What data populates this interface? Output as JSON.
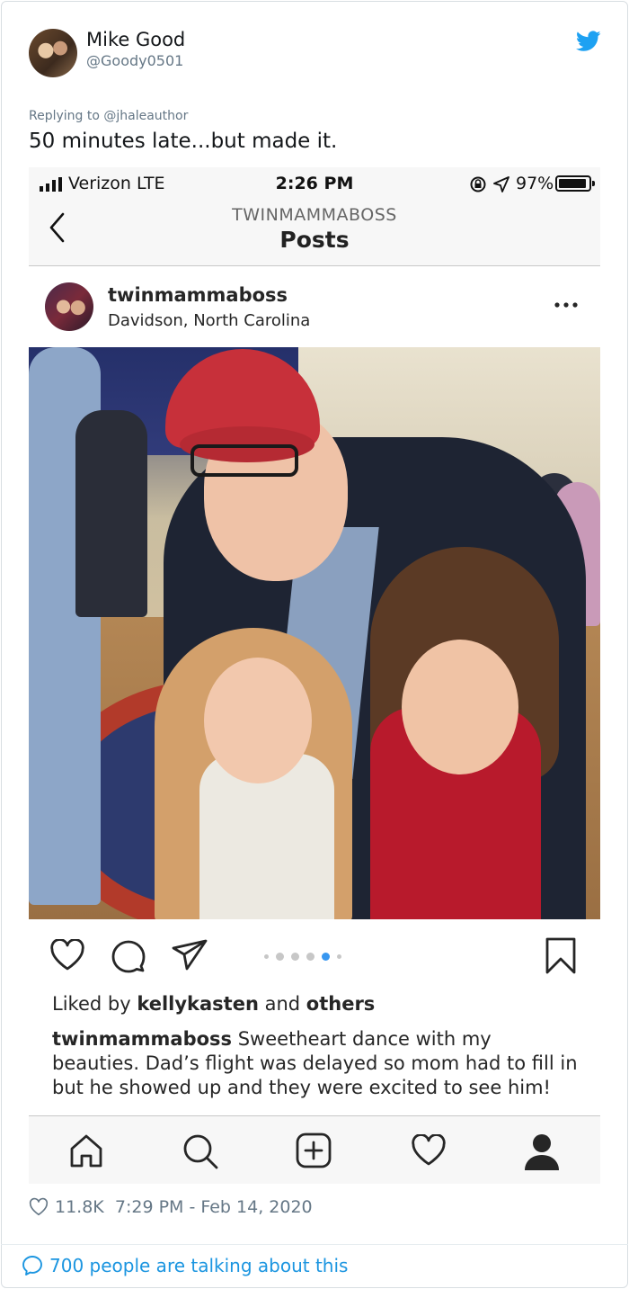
{
  "tweet": {
    "author_name": "Mike Good",
    "author_handle": "@Goody0501",
    "replying_to": "Replying to @jhaleauthor",
    "text": "50 minutes late...but made it.",
    "like_count": "11.8K",
    "timestamp": "7:29 PM - Feb 14, 2020",
    "talking": "700 people are talking about this",
    "brand_color": "#1da1f2",
    "link_color": "#1b95e0"
  },
  "screenshot": {
    "status_bar": {
      "carrier": "Verizon  LTE",
      "time": "2:26 PM",
      "battery": "97%"
    },
    "nav": {
      "subtitle": "TWINMAMMABOSS",
      "title": "Posts"
    },
    "post": {
      "username": "twinmammaboss",
      "location": "Davidson, North Carolina",
      "liked_by_prefix": "Liked by ",
      "liked_by_user": "kellykasten",
      "liked_by_mid": " and ",
      "liked_by_others": "others",
      "caption_user": "twinmammaboss",
      "caption_text": " Sweetheart dance with my beauties. Dad’s flight was delayed so mom had to fill in but he showed up and they were excited to see him!",
      "carousel_count": 6,
      "carousel_active": 4,
      "carousel_active_color": "#3897f0"
    },
    "icons": {
      "actions": [
        "heart-icon",
        "comment-icon",
        "share-icon",
        "bookmark-icon"
      ],
      "tabbar": [
        "home-icon",
        "search-icon",
        "add-post-icon",
        "activity-heart-icon",
        "profile-icon"
      ]
    }
  }
}
